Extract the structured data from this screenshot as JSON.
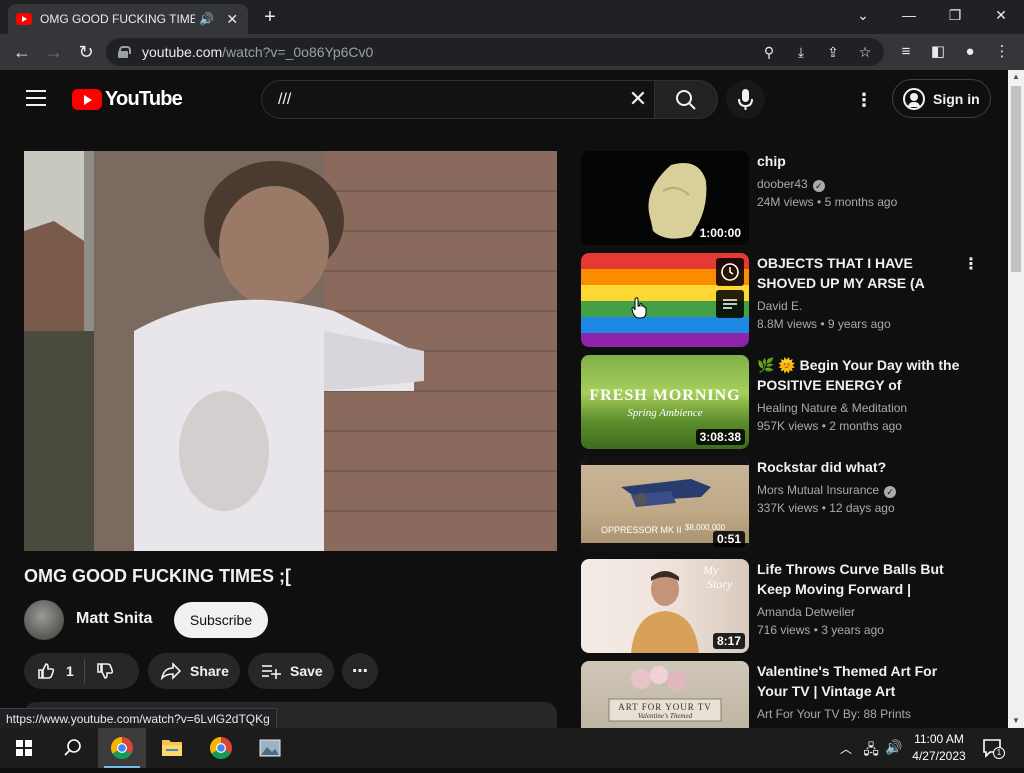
{
  "browser": {
    "tab_title": "OMG GOOD FUCKING TIMES ;[ - YouTube",
    "url_host": "youtube.com",
    "url_path": "/watch?v=_0o86Yp6Cv0",
    "status_url": "https://www.youtube.com/watch?v=6LvlG2dTQKg"
  },
  "youtube": {
    "logo_text": "YouTube",
    "search_value": "///",
    "sign_in_label": "Sign in"
  },
  "video": {
    "title": "OMG GOOD FUCKING TIMES ;[",
    "channel": "Matt Snita",
    "subscribe_label": "Subscribe",
    "likes": "1",
    "share_label": "Share",
    "save_label": "Save"
  },
  "recommendations": [
    {
      "title": "chip",
      "channel": "doober43",
      "verified": true,
      "views": "24M views",
      "age": "5 months ago",
      "duration": "1:00:00"
    },
    {
      "title": "OBJECTS THAT I HAVE SHOVED UP MY ARSE (A Brun...",
      "channel": "David E.",
      "verified": false,
      "views": "8.8M views",
      "age": "9 years ago",
      "duration": ""
    },
    {
      "title": "🌿 🌞 Begin Your Day with the POSITIVE ENERGY of Healing...",
      "channel": "Healing Nature & Meditation",
      "verified": false,
      "views": "957K views",
      "age": "2 months ago",
      "duration": "3:08:38",
      "thumb_text_1": "FRESH MORNING",
      "thumb_text_2": "Spring Ambience"
    },
    {
      "title": "Rockstar did what?",
      "channel": "Mors Mutual Insurance",
      "verified": true,
      "views": "337K views",
      "age": "12 days ago",
      "duration": "0:51",
      "thumb_text_1": "OPPRESSOR MK II",
      "thumb_text_2": "$8,000,000"
    },
    {
      "title": "Life Throws Curve Balls But Keep Moving Forward | Justin'...",
      "channel": "Amanda Detweiler",
      "verified": false,
      "views": "716 views",
      "age": "3 years ago",
      "duration": "8:17",
      "thumb_text_1": "My",
      "thumb_text_2": "Story"
    },
    {
      "title": "Valentine's Themed Art For Your TV | Vintage Art Slideshow For...",
      "channel": "Art For Your TV By: 88 Prints",
      "verified": false,
      "views": "",
      "age": "",
      "duration": "",
      "thumb_text_1": "ART FOR YOUR TV",
      "thumb_text_2": "Valentine's Themed"
    }
  ],
  "taskbar": {
    "time": "11:00 AM",
    "date": "4/27/2023",
    "notification_count": "1"
  },
  "colors": {
    "youtube_red": "#ff0000",
    "page_bg": "#0f0f0f",
    "chrome_dark": "#202124"
  }
}
